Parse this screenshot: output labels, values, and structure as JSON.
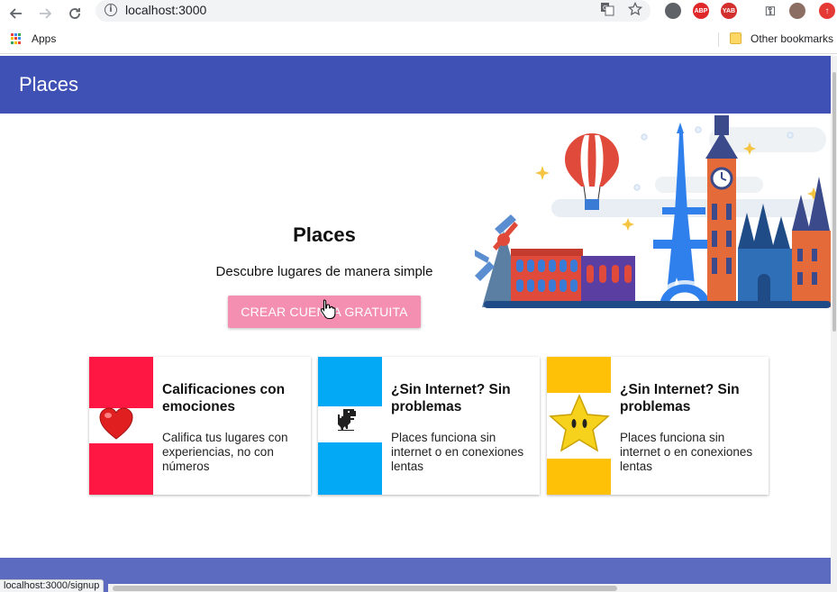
{
  "browser": {
    "url": "localhost:3000",
    "bookmarks": {
      "apps_label": "Apps",
      "other_label": "Other bookmarks"
    },
    "status_url": "localhost:3000/signup",
    "extensions": [
      {
        "name": "adblock-icon",
        "text": "ABP",
        "color": "#e0282b"
      },
      {
        "name": "yab-icon",
        "text": "YAB",
        "color": "#d32f2f"
      }
    ]
  },
  "appbar": {
    "title": "Places"
  },
  "hero": {
    "title": "Places",
    "subtitle": "Descubre lugares de manera simple",
    "cta_label": "CREAR CUENTA GRATUITA"
  },
  "cards": [
    {
      "title": "Calificaciones con emociones",
      "text": "Califica tus lugares con experiencias, no con números",
      "color": "#ff1744",
      "icon": "heart-emoji-icon"
    },
    {
      "title": "¿Sin Internet? Sin problemas",
      "text": "Places funciona sin internet o en conexiones lentas",
      "color": "#03a9f4",
      "icon": "dinosaur-icon"
    },
    {
      "title": "¿Sin Internet? Sin problemas",
      "text": "Places funciona sin internet o en conexiones lentas",
      "color": "#ffc107",
      "icon": "star-icon"
    }
  ],
  "colors": {
    "primary": "#3f51b5",
    "footer": "#5c6bc0",
    "accent": "#f48fb1"
  }
}
